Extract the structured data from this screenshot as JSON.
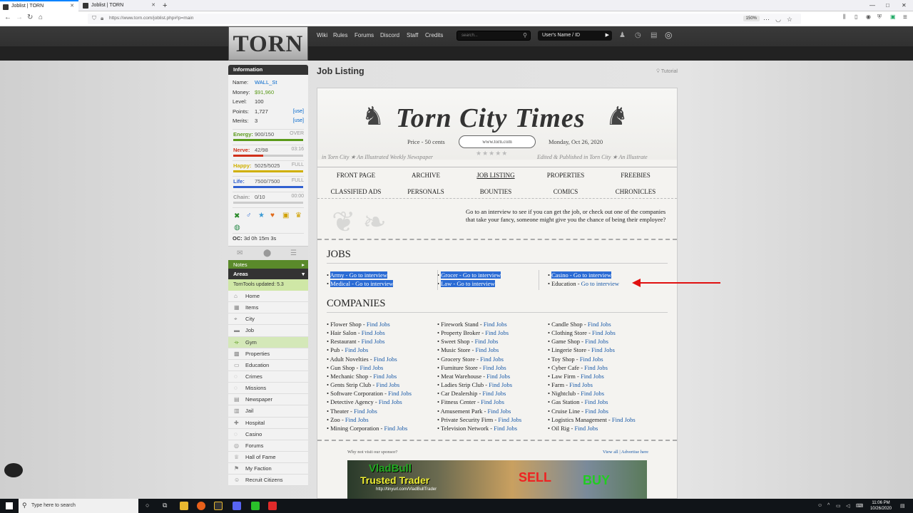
{
  "browser": {
    "tabs": [
      {
        "title": "Joblist | TORN",
        "active": true
      },
      {
        "title": "Joblist | TORN",
        "active": false
      }
    ],
    "url": "https://www.torn.com/joblist.php#!p=main",
    "zoom": "150%"
  },
  "header": {
    "logo": "TORN",
    "links": [
      "Wiki",
      "Rules",
      "Forums",
      "Discord",
      "Staff",
      "Credits"
    ],
    "search_placeholder": "search...",
    "user_placeholder": "User's Name / ID"
  },
  "sidebar": {
    "info_title": "Information",
    "info": {
      "name_label": "Name:",
      "name": "WALL_St",
      "money_label": "Money:",
      "money": "$91,960",
      "level_label": "Level:",
      "level": "100",
      "points_label": "Points:",
      "points": "1,727",
      "merits_label": "Merits:",
      "merits": "3",
      "use": "[use]"
    },
    "bars": [
      {
        "label": "Energy:",
        "value": "900/150",
        "right": "OVER",
        "color": "#5a9a1a",
        "fill": 1.0
      },
      {
        "label": "Nerve:",
        "value": "42/98",
        "right": "03:16",
        "color": "#d0301a",
        "fill": 0.43
      },
      {
        "label": "Happy:",
        "value": "5025/5025",
        "right": "FULL",
        "color": "#d0b000",
        "fill": 1.0
      },
      {
        "label": "Life:",
        "value": "7500/7500",
        "right": "FULL",
        "color": "#3060d0",
        "fill": 1.0
      },
      {
        "label": "Chain:",
        "value": "0/10",
        "right": "00:00",
        "color": "#999999",
        "fill": 0.0
      }
    ],
    "oc_label": "OC:",
    "oc": "3d 0h 15m 3s",
    "notes": "Notes",
    "areas": "Areas",
    "torntools": "TornTools updated: 5.3",
    "nav": [
      "Home",
      "Items",
      "City",
      "Job",
      "Gym",
      "Properties",
      "Education",
      "Crimes",
      "Missions",
      "Newspaper",
      "Jail",
      "Hospital",
      "Casino",
      "Forums",
      "Hall of Fame",
      "My Faction",
      "Recruit Citizens"
    ]
  },
  "main": {
    "title": "Job Listing",
    "tutorial": "Tutorial",
    "paper": {
      "masthead": "Torn City Times",
      "price": "Price - 50 cents",
      "date": "Monday, Oct 26, 2020",
      "site": "www.torn.com",
      "tagline_left": "in Torn City  ★  An Illustrated Weekly Newspaper",
      "tagline_right": "Edited & Published in Torn City  ★  An Illustrate",
      "nav": [
        "FRONT PAGE",
        "ARCHIVE",
        "JOB LISTING",
        "PROPERTIES",
        "FREEBIES",
        "CLASSIFIED ADS",
        "PERSONALS",
        "BOUNTIES",
        "COMICS",
        "CHRONICLES"
      ],
      "intro": "Go to an interview to see if you can get the job, or check out one of the companies that take your fancy, someone might give you the chance of being their employee?",
      "jobs_title": "JOBS",
      "jobs": [
        [
          {
            "name": "Army",
            "link": "Go to interview",
            "sel": true
          },
          {
            "name": "Medical",
            "link": "Go to interview",
            "sel": true
          }
        ],
        [
          {
            "name": "Grocer",
            "link": "Go to interview",
            "sel": true
          },
          {
            "name": "Law",
            "link": "Go to interview",
            "sel": true
          }
        ],
        [
          {
            "name": "Casino",
            "link": "Go to interview",
            "sel": true
          },
          {
            "name": "Education",
            "link": "Go to interview",
            "sel": false
          }
        ]
      ],
      "companies_title": "COMPANIES",
      "find_jobs": "Find Jobs",
      "companies": [
        [
          "Flower Shop",
          "Hair Salon",
          "Restaurant",
          "Pub",
          "Adult Novelties",
          "Gun Shop",
          "Mechanic Shop",
          "Gents Strip Club",
          "Software Corporation",
          "Detective Agency",
          "Theater",
          "Zoo",
          "Mining Corporation"
        ],
        [
          "Firework Stand",
          "Property Broker",
          "Sweet Shop",
          "Music Store",
          "Grocery Store",
          "Furniture Store",
          "Meat Warehouse",
          "Ladies Strip Club",
          "Car Dealership",
          "Fitness Center",
          "Amusement Park",
          "Private Security Firm",
          "Television Network"
        ],
        [
          "Candle Shop",
          "Clothing Store",
          "Game Shop",
          "Lingerie Store",
          "Toy Shop",
          "Cyber Cafe",
          "Law Firm",
          "Farm",
          "Nightclub",
          "Gas Station",
          "Cruise Line",
          "Logistics Management",
          "Oil Rig"
        ]
      ],
      "ad_why": "Why not visit our sponsor?",
      "ad_links": "View all | Advertise here",
      "ad_line1": "VladBull",
      "ad_line2": "Trusted Trader",
      "ad_line3": "http://tinyurl.com/VladBullTrader",
      "ad_sell": "SELL",
      "ad_buy": "BUY"
    }
  },
  "taskbar": {
    "search": "Type here to search",
    "time": "11:06 PM",
    "date": "10/26/2020"
  },
  "colors": {
    "accent": "#0a84ff",
    "link": "#1a5aa8",
    "selection": "#2a6bd4",
    "arrow": "#e01010"
  }
}
